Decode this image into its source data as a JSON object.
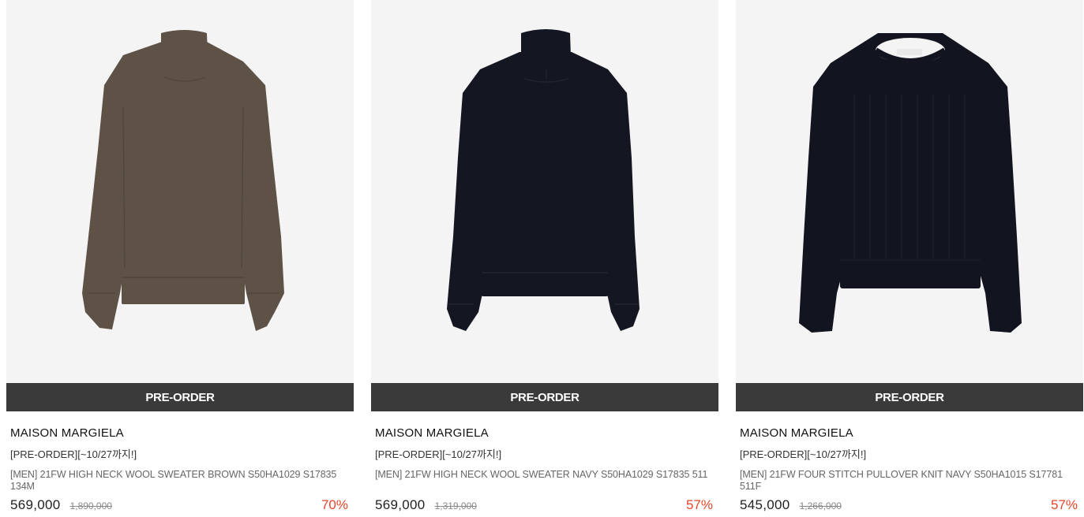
{
  "products": [
    {
      "badge": "PRE-ORDER",
      "brand": "MAISON MARGIELA",
      "tag": "[PRE-ORDER][~10/27까지!]",
      "name": "[MEN] 21FW HIGH NECK WOOL SWEATER BROWN S50HA1029 S17835 134M",
      "price": "569,000",
      "original_price": "1,890,000",
      "discount": "70%",
      "color": "#5e5146",
      "style": "high-neck"
    },
    {
      "badge": "PRE-ORDER",
      "brand": "MAISON MARGIELA",
      "tag": "[PRE-ORDER][~10/27까지!]",
      "name": "[MEN] 21FW HIGH NECK WOOL SWEATER NAVY S50HA1029 S17835 511",
      "price": "569,000",
      "original_price": "1,319,000",
      "discount": "57%",
      "color": "#141722",
      "style": "high-neck"
    },
    {
      "badge": "PRE-ORDER",
      "brand": "MAISON MARGIELA",
      "tag": "[PRE-ORDER][~10/27까지!]",
      "name": "[MEN] 21FW FOUR STITCH PULLOVER KNIT NAVY S50HA1015 S17781 511F",
      "price": "545,000",
      "original_price": "1,266,000",
      "discount": "57%",
      "color": "#121520",
      "style": "crew-neck"
    }
  ],
  "colors": {
    "badge_bg": "#3a3a3a",
    "discount": "#e2462a",
    "thumb_bg": "#f4f4f4"
  }
}
